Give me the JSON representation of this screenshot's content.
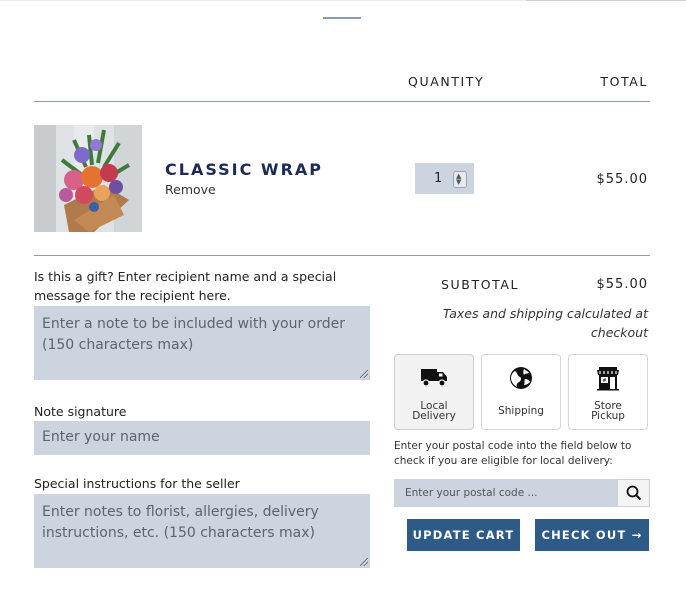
{
  "header": {
    "quantity": "QUANTITY",
    "total": "TOTAL"
  },
  "item": {
    "title": "CLASSIC WRAP",
    "remove": "Remove",
    "quantity": "1",
    "price": "$55.00",
    "image_icon": "flower-bouquet-image"
  },
  "gift": {
    "label": "Is this a gift? Enter recipient name and a special message for the recipient here.",
    "placeholder": "Enter a note to be included with your order (150 characters max)"
  },
  "signature": {
    "label": "Note signature",
    "placeholder": "Enter your name"
  },
  "instructions": {
    "label": "Special instructions for the seller",
    "placeholder": "Enter notes to florist, allergies, delivery instructions, etc. (150 characters max)"
  },
  "summary": {
    "subtotal_label": "SUBTOTAL",
    "subtotal_value": "$55.00",
    "tax_note": "Taxes and shipping calculated at checkout"
  },
  "delivery_options": [
    {
      "label_line1": "Local",
      "label_line2": "Delivery",
      "icon": "truck-icon",
      "selected": true
    },
    {
      "label_line1": "Shipping",
      "label_line2": "",
      "icon": "globe-icon",
      "selected": false
    },
    {
      "label_line1": "Store",
      "label_line2": "Pickup",
      "icon": "store-icon",
      "selected": false
    }
  ],
  "postal": {
    "note": "Enter your postal code into the field below to check if you are eligible for local delivery:",
    "placeholder": "Enter your postal code ..."
  },
  "buttons": {
    "update": "UPDATE CART",
    "checkout": "CHECK OUT →"
  },
  "colors": {
    "accent": "#2e5a87",
    "field_bg": "#cbd4df",
    "title": "#1b2b55"
  }
}
